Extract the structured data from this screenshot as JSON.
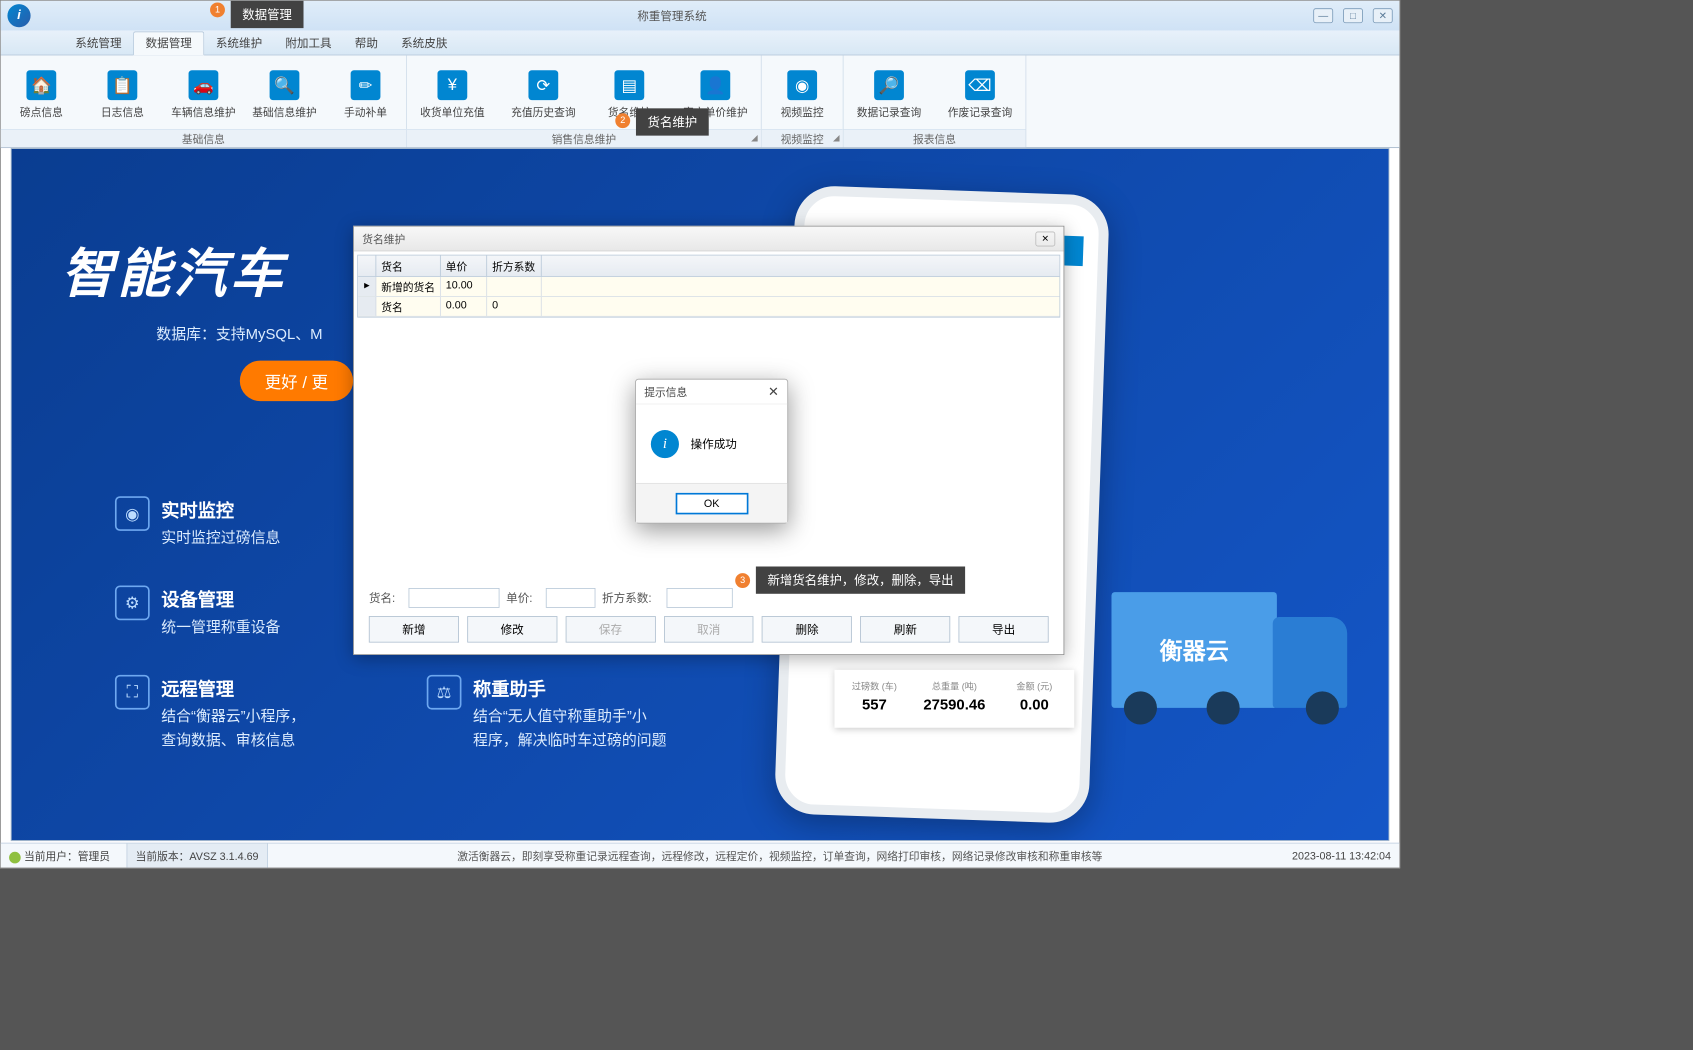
{
  "window": {
    "title": "称重管理系统",
    "minimize": "—",
    "maximize": "□",
    "close": "✕"
  },
  "annotations": {
    "badge1": "1",
    "tooltip1": "数据管理",
    "badge2": "2",
    "tooltip2": "货名维护",
    "badge3": "3",
    "tooltip3": "新增货名维护，修改，删除，导出"
  },
  "menu": {
    "items": [
      "系统管理",
      "数据管理",
      "系统维护",
      "附加工具",
      "帮助",
      "系统皮肤"
    ],
    "active_index": 1
  },
  "ribbon": {
    "groups": [
      {
        "label": "基础信息",
        "items": [
          {
            "icon": "🏠",
            "label": "磅点信息"
          },
          {
            "icon": "📋",
            "label": "日志信息"
          },
          {
            "icon": "🚗",
            "label": "车辆信息维护"
          },
          {
            "icon": "🔍",
            "label": "基础信息维护"
          },
          {
            "icon": "✏️",
            "label": "手动补单"
          }
        ]
      },
      {
        "label": "销售信息维护",
        "items": [
          {
            "icon": "¥",
            "label": "收货单位充值"
          },
          {
            "icon": "⏱",
            "label": "充值历史查询"
          },
          {
            "icon": "📄",
            "label": "货名维护"
          },
          {
            "icon": "👤",
            "label": "客户单价维护"
          }
        ]
      },
      {
        "label": "视频监控",
        "items": [
          {
            "icon": "📷",
            "label": "视频监控"
          }
        ]
      },
      {
        "label": "报表信息",
        "items": [
          {
            "icon": "🔎",
            "label": "数据记录查询"
          },
          {
            "icon": "🗑",
            "label": "作废记录查询"
          }
        ]
      }
    ]
  },
  "background": {
    "title": "智能汽车",
    "db_text": "数据库：支持MySQL、M",
    "capsule": "更好 / 更",
    "features": [
      {
        "title": "实时监控",
        "desc": "实时监控过磅信息"
      },
      {
        "title": "设备管理",
        "desc": "统一管理称重设备"
      },
      {
        "title": "远程管理",
        "desc": "结合“衡器云”小程序，\n查询数据、审核信息"
      },
      {
        "title": "称重助手",
        "desc": "结合“无人值守称重助手”小\n程序，解决临时车过磅的问题"
      }
    ],
    "phone_stats": [
      {
        "label": "过磅数 (车)",
        "value": "557"
      },
      {
        "label": "总重量 (吨)",
        "value": "27590.46"
      },
      {
        "label": "金额 (元)",
        "value": "0.00"
      }
    ],
    "truck_label": "衡器云"
  },
  "goods_dialog": {
    "title": "货名维护",
    "columns": [
      "货名",
      "单价",
      "折方系数"
    ],
    "rows": [
      {
        "name": "新增的货名",
        "price": "10.00",
        "coef": ""
      },
      {
        "name": "货名",
        "price": "0.00",
        "coef": "0"
      }
    ],
    "form": {
      "name_label": "货名:",
      "price_label": "单价:",
      "coef_label": "折方系数:"
    },
    "buttons": {
      "add": "新增",
      "edit": "修改",
      "save": "保存",
      "cancel": "取消",
      "delete": "删除",
      "refresh": "刷新",
      "export": "导出"
    }
  },
  "msgbox": {
    "title": "提示信息",
    "text": "操作成功",
    "ok": "OK"
  },
  "statusbar": {
    "user": "当前用户：管理员",
    "version": "当前版本：AVSZ 3.1.4.69",
    "scrolltext": "激活衡器云，即刻享受称重记录远程查询，远程修改，远程定价，视频监控，订单查询，网络打印审核，网络记录修改审核和称重审核等",
    "datetime": "2023-08-11 13:42:04"
  }
}
